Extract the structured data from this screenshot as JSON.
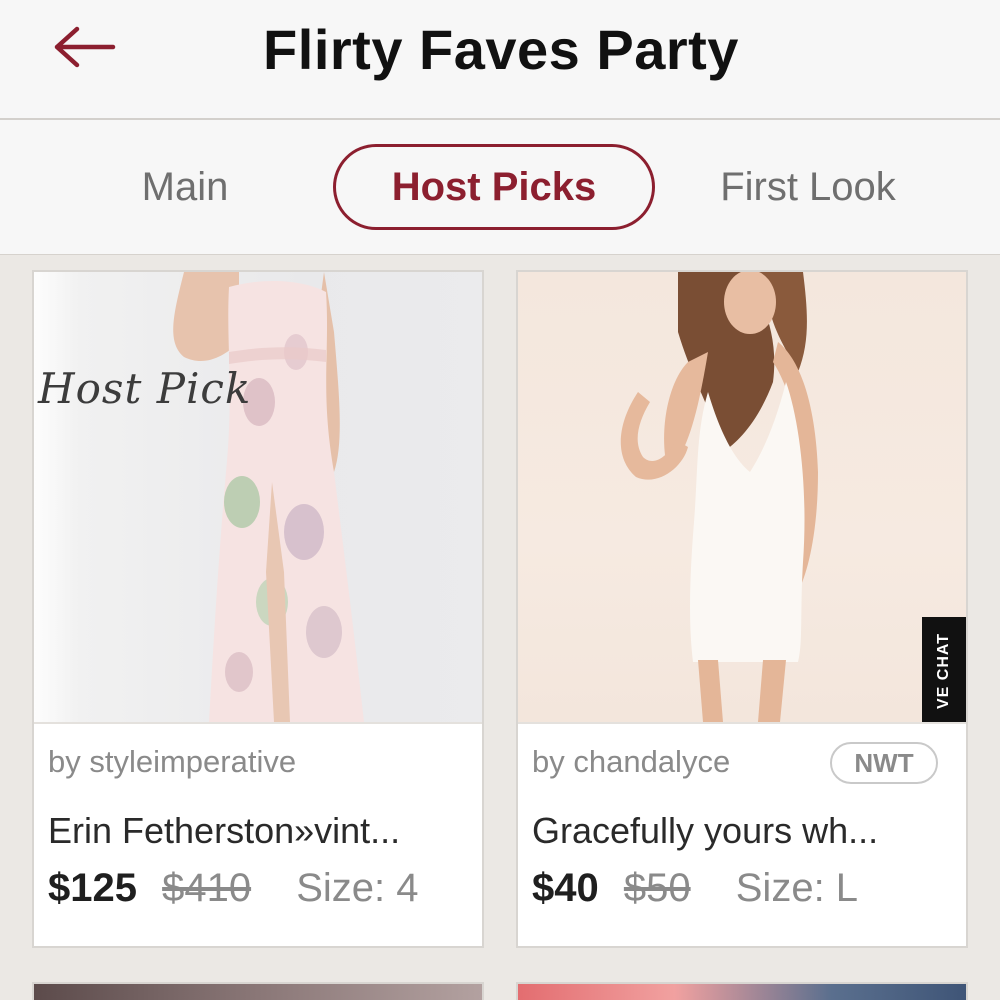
{
  "header": {
    "back_icon": "arrow-left-icon",
    "title": "Flirty Faves Party",
    "accent_color": "#8c1f2f"
  },
  "tabs": [
    {
      "label": "Main",
      "selected": false
    },
    {
      "label": "Host Picks",
      "selected": true
    },
    {
      "label": "First Look",
      "selected": false
    }
  ],
  "listings": [
    {
      "overlay_text": "Host Pick",
      "seller": "by styleimperative",
      "title": "Erin Fetherston»vint...",
      "price": "$125",
      "original_price": "$410",
      "size": "Size: 4"
    },
    {
      "badge": "NWT",
      "side_tab": "VE CHAT",
      "seller": "by chandalyce",
      "title": "Gracefully yours wh...",
      "price": "$40",
      "original_price": "$50",
      "size": "Size: L"
    }
  ]
}
